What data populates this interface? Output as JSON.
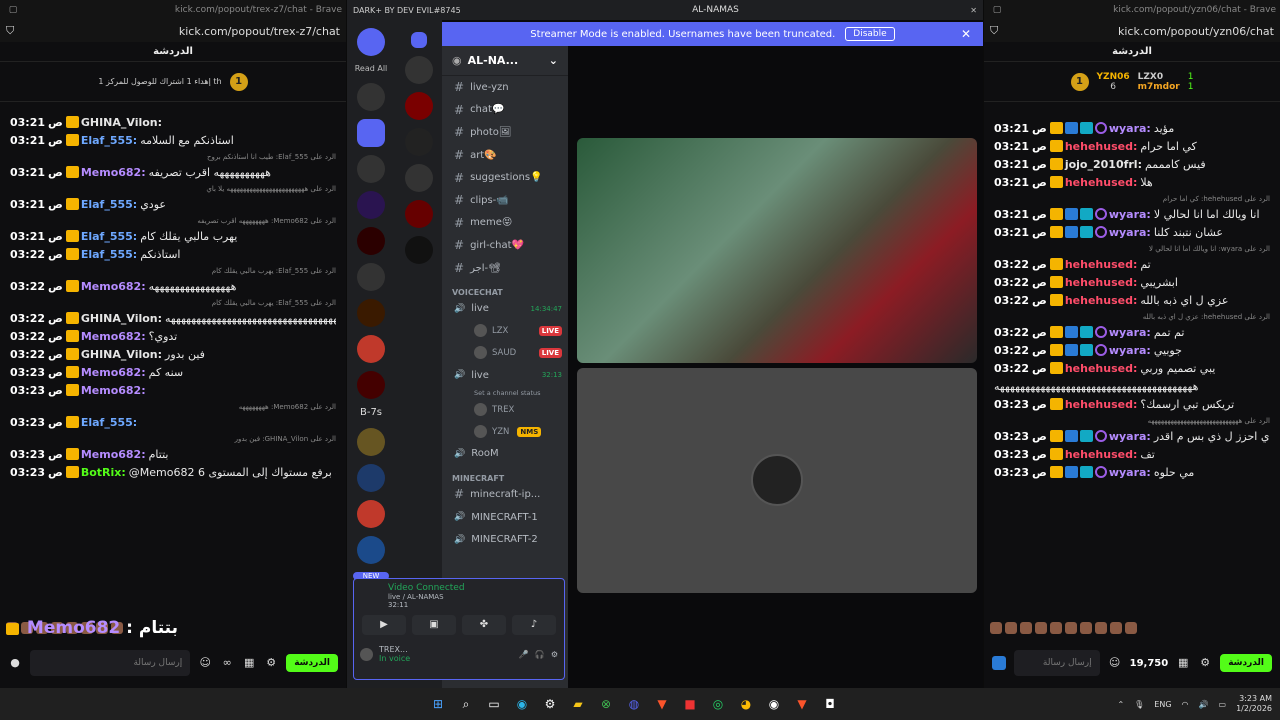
{
  "left_window": {
    "title": "kick.com/popout/trex-z7/chat - Brave",
    "url": "kick.com/popout/trex-z7/chat",
    "chat_header": "الدردشة",
    "pinned_coin": "1",
    "pinned_text": "إهداء 1 اشتراك للوصول للمركز 1 th",
    "messages": [
      {
        "time": "03:21",
        "user": "GHINA_Vilon:",
        "text": "",
        "color": "#e6e6e6"
      },
      {
        "time": "03:21",
        "user": "Elaf_555:",
        "text": "استاذنكم مع السلامه",
        "color": "#6ea8ff"
      },
      {
        "reply": "الرد على Elaf_555: طيب انا استاذنكم بروح"
      },
      {
        "time": "03:21",
        "user": "Memo682:",
        "text": "ههههههههههه اقرب تصريفه",
        "color": "#b58cff"
      },
      {
        "reply": "الرد على ههههههههههههههههههههههههه يلا باي"
      },
      {
        "time": "03:21",
        "user": "Elaf_555:",
        "text": "عودي",
        "color": "#6ea8ff"
      },
      {
        "reply": "الرد على Memo682: ههههههههه اقرب تصريفه"
      },
      {
        "time": "03:21",
        "user": "Elaf_555:",
        "text": "يهرب مالبي يقلك كام",
        "color": "#6ea8ff"
      },
      {
        "time": "03:22",
        "user": "Elaf_555:",
        "text": "استاذنكم",
        "color": "#6ea8ff"
      },
      {
        "reply": "الرد على Elaf_555: يهرب مالبي يقلك كام"
      },
      {
        "time": "03:22",
        "user": "Memo682:",
        "text": "ههههههههههههههههه",
        "color": "#b58cff"
      },
      {
        "reply": "الرد على Elaf_555: يهرب مالبي يقلك كام"
      },
      {
        "time": "03:22",
        "user": "GHINA_Vilon:",
        "text": "ههههههههههههههههههههههههههههههههههههههههههه",
        "color": "#e6e6e6"
      },
      {
        "time": "03:22",
        "user": "Memo682:",
        "text": "تدوي؟",
        "color": "#b58cff"
      },
      {
        "time": "03:22",
        "user": "GHINA_Vilon:",
        "text": "فين بدور",
        "color": "#e6e6e6"
      },
      {
        "time": "03:23",
        "user": "Memo682:",
        "text": "سنه كم",
        "color": "#b58cff"
      },
      {
        "time": "03:23",
        "user": "Memo682:",
        "text": "",
        "color": "#b58cff"
      },
      {
        "reply": "الرد على Memo682: ههههههههه"
      },
      {
        "time": "03:23",
        "user": "Elaf_555:",
        "text": "",
        "color": "#6ea8ff"
      },
      {
        "reply": "الرد على GHINA_Vilon: فين بدور"
      },
      {
        "time": "03:23",
        "user": "Memo682:",
        "text": "بتتام",
        "color": "#b58cff"
      },
      {
        "time": "03:23",
        "user": "BotRix:",
        "text": "@Memo682 قمت برفع مستواك إلى المستوى 6",
        "color": "#53fc18"
      }
    ],
    "time_suffix": "ص",
    "overlay_name": "Memo682",
    "overlay_text": ": بتتام",
    "input_placeholder": "إرسال رسالة",
    "send_label": "الدردشة"
  },
  "right_window": {
    "title": "kick.com/popout/yzn06/chat - Brave",
    "url": "kick.com/popout/yzn06/chat",
    "chat_header": "الدردشة",
    "leader1": "YZN06",
    "leader1_count": "6",
    "leader2": "LZX0",
    "leader2_count": "1",
    "leader3": "m7mdor",
    "leader3_count": "1",
    "coin": "1",
    "messages": [
      {
        "time": "03:21",
        "user": "wyara:",
        "text": "مؤيد",
        "color": "#b58cff"
      },
      {
        "time": "03:21",
        "user": "hehehused:",
        "text": "كي اما حرام",
        "color": "#ff4d6a"
      },
      {
        "time": "03:21",
        "user": "jojo_2010frl:",
        "text": "فيس كامممم",
        "color": "#e6e6e6"
      },
      {
        "time": "03:21",
        "user": "hehehused:",
        "text": "هلا",
        "color": "#ff4d6a"
      },
      {
        "reply": "الرد على hehehused: كي اما حرام"
      },
      {
        "time": "03:21",
        "user": "wyara:",
        "text": "انا ويالك اما انا لحالي لا",
        "color": "#b58cff"
      },
      {
        "time": "03:21",
        "user": "wyara:",
        "text": "عشان نتبند كلنا",
        "color": "#b58cff"
      },
      {
        "reply": "الرد على wyara: انا ويالك اما انا لحالي لا"
      },
      {
        "time": "03:22",
        "user": "hehehused:",
        "text": "تم",
        "color": "#ff4d6a"
      },
      {
        "time": "03:22",
        "user": "hehehused:",
        "text": "ابشريبي",
        "color": "#ff4d6a"
      },
      {
        "time": "03:22",
        "user": "hehehused:",
        "text": "عزي ل اي ذبه بالله",
        "color": "#ff4d6a"
      },
      {
        "reply": "الرد على hehehused: عزي ل اي ذبه بالله"
      },
      {
        "time": "03:22",
        "user": "wyara:",
        "text": "تم تمم",
        "color": "#b58cff"
      },
      {
        "time": "03:22",
        "user": "wyara:",
        "text": "جوبيي",
        "color": "#b58cff"
      },
      {
        "time": "03:22",
        "user": "hehehused:",
        "text": "يبي تصميم وربي",
        "color": "#ff4d6a"
      },
      {
        "time": "",
        "user": "",
        "text": "هههههههههههههههههههههههههههههههههههههههه",
        "color": "#e6e6e6"
      },
      {
        "time": "03:23",
        "user": "hehehused:",
        "text": "تريكس تبي ارسمك؟",
        "color": "#ff4d6a"
      },
      {
        "reply": "الرد على ههههههههههههههههههههههههههههه"
      },
      {
        "time": "03:23",
        "user": "wyara:",
        "text": "ودي احزز ل ذي بس م اقدر",
        "color": "#b58cff"
      },
      {
        "time": "03:23",
        "user": "hehehused:",
        "text": "تف",
        "color": "#ff4d6a"
      },
      {
        "time": "03:23",
        "user": "wyara:",
        "text": "مي حلوه",
        "color": "#b58cff"
      }
    ],
    "time_suffix": "ص",
    "input_placeholder": "إرسال رسالة",
    "points": "19,750",
    "send_label": "الدردشة"
  },
  "discord": {
    "app_title": "DARK+ BY DEV EVIL#8745",
    "window_title": "AL-NAMAS",
    "banner_text": "Streamer Mode is enabled. Usernames have been truncated.",
    "banner_button": "Disable",
    "read_all": "Read All",
    "server_name": "AL-NA...",
    "server_badge": "B-7s",
    "new_badge": "NEW",
    "channels_top": [
      "live-yzn",
      "chat💬",
      "photo🖼",
      "art🎨",
      "suggestions💡",
      "clips-📹",
      "meme😝",
      "girl-chat💖",
      "اجر-📽"
    ],
    "voice_category": "VOICECHAT",
    "voice1": {
      "name": "live",
      "timer": "14:34:47",
      "users": [
        {
          "name": "LZX",
          "badge": "LIVE"
        },
        {
          "name": "SAUD",
          "badge": "LIVE"
        }
      ]
    },
    "voice2": {
      "name": "live",
      "timer": "32:13",
      "status": "Set a channel status",
      "users": [
        {
          "name": "TREX",
          "badge": ""
        },
        {
          "name": "YZN",
          "badge": "NMS"
        }
      ]
    },
    "room": "RooM",
    "minecraft_category": "MINECRAFT",
    "minecraft_channels": [
      "minecraft-ip...",
      "MINECRAFT-1",
      "MINECRAFT-2"
    ],
    "voice_panel": {
      "status": "Video Connected",
      "channel": "live / AL-NAMAS",
      "timer": "32:11"
    },
    "user": {
      "name": "TREX...",
      "status": "In voice"
    }
  },
  "taskbar": {
    "lang": "ENG",
    "time": "3:23 AM",
    "date": "1/2/2026"
  }
}
